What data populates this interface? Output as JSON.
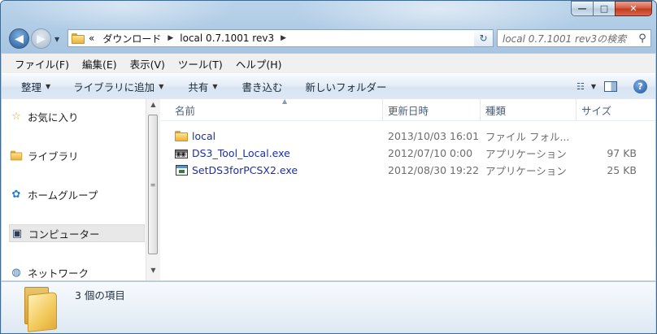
{
  "window": {
    "controls": {
      "minimize": "—",
      "maximize": "□",
      "close": "✕"
    }
  },
  "address": {
    "overflow": "«",
    "crumbs": [
      "ダウンロード",
      "local 0.7.1001 rev3"
    ],
    "search_placeholder": "local 0.7.1001 rev3の検索"
  },
  "menu": [
    "ファイル(F)",
    "編集(E)",
    "表示(V)",
    "ツール(T)",
    "ヘルプ(H)"
  ],
  "toolbar": {
    "organize": "整理",
    "include_library": "ライブラリに追加",
    "share": "共有",
    "burn": "書き込む",
    "new_folder": "新しいフォルダー"
  },
  "nav": {
    "favorites": "お気に入り",
    "libraries": "ライブラリ",
    "homegroup": "ホームグループ",
    "computer": "コンピューター",
    "network": "ネットワーク"
  },
  "columns": {
    "name": "名前",
    "date": "更新日時",
    "type": "種類",
    "size": "サイズ"
  },
  "files": [
    {
      "name": "local",
      "date": "2013/10/03 16:01",
      "type": "ファイル フォル...",
      "size": "",
      "icon": "folder-icon"
    },
    {
      "name": "DS3_Tool_Local.exe",
      "date": "2012/07/10 0:00",
      "type": "アプリケーション",
      "size": "97 KB",
      "icon": "gear-app-icon"
    },
    {
      "name": "SetDS3forPCSX2.exe",
      "date": "2012/08/30 19:22",
      "type": "アプリケーション",
      "size": "25 KB",
      "icon": "app-window-icon"
    }
  ],
  "status": {
    "item_count": "3 個の項目"
  }
}
